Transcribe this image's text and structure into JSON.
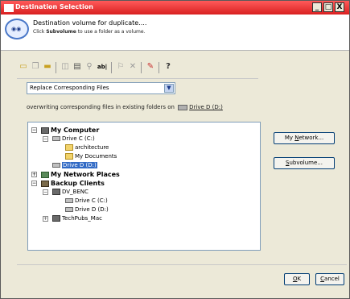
{
  "window": {
    "title": "Destination Selection",
    "minimize": "_",
    "maximize": "□",
    "close": "X"
  },
  "header": {
    "line1": "Destination volume for duplicate....",
    "line2_pre": "Click ",
    "line2_bold": "Subvolume",
    "line2_post": " to use a folder as a volume."
  },
  "toolbar": {
    "icons": [
      "folder-open-icon",
      "copy-icon",
      "folder-icon",
      "window-icon",
      "properties-icon",
      "filter-icon",
      "rename-icon",
      "comment-icon",
      "delete-icon",
      "erase-icon",
      "help-icon"
    ]
  },
  "select": {
    "value": "Replace Corresponding Files",
    "arrow": "▼"
  },
  "info": {
    "text": "overwriting corresponding files in existing folders on",
    "drive": "Drive D (D:)"
  },
  "tree": {
    "nodes": [
      {
        "label": "My Computer",
        "expander": "−",
        "icon": "comp"
      },
      {
        "label": "Drive C (C:)",
        "expander": "−",
        "icon": "drive"
      },
      {
        "label": "architecture",
        "expander": "",
        "icon": "folder"
      },
      {
        "label": "My Documents",
        "expander": "",
        "icon": "folder"
      },
      {
        "label": "Drive D (D:)",
        "expander": "",
        "icon": "drive",
        "selected": true
      },
      {
        "label": "My Network Places",
        "expander": "+",
        "icon": "net"
      },
      {
        "label": "Backup Clients",
        "expander": "−",
        "icon": "backup"
      },
      {
        "label": "DV_BENC",
        "expander": "−",
        "icon": "comp"
      },
      {
        "label": "Drive C (C:)",
        "expander": "",
        "icon": "drive"
      },
      {
        "label": "Drive D (D:)",
        "expander": "",
        "icon": "drive"
      },
      {
        "label": "TechPubs_Mac",
        "expander": "+",
        "icon": "comp"
      }
    ]
  },
  "buttons": {
    "network_pre": "My ",
    "network_u": "N",
    "network_post": "etwork...",
    "subvolume_u": "S",
    "subvolume_post": "ubvolume...",
    "ok_u": "O",
    "ok_post": "K",
    "cancel_u": "C",
    "cancel_post": "ancel"
  },
  "colors": {
    "titlebar": "#d92020",
    "selection": "#316ac5"
  }
}
